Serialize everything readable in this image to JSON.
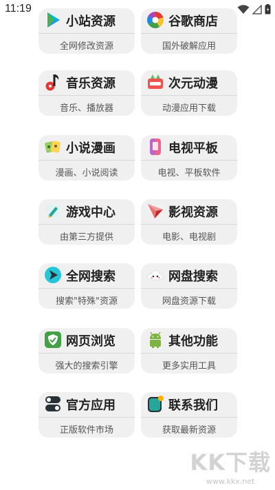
{
  "status_bar": {
    "time": "11:19"
  },
  "cards": [
    {
      "title": "小站资源",
      "subtitle": "全网修改资源",
      "icon": "play-triangle-icon"
    },
    {
      "title": "谷歌商店",
      "subtitle": "国外破解应用",
      "icon": "google-play-icon"
    },
    {
      "title": "音乐资源",
      "subtitle": "音乐、播放器",
      "icon": "music-note-icon"
    },
    {
      "title": "次元动漫",
      "subtitle": "动漫应用下载",
      "icon": "anime-box-icon"
    },
    {
      "title": "小说漫画",
      "subtitle": "漫画、小说阅读",
      "icon": "comic-book-icon"
    },
    {
      "title": "电视平板",
      "subtitle": "电视、平板软件",
      "icon": "tv-tablet-icon"
    },
    {
      "title": "游戏中心",
      "subtitle": "由第三方提供",
      "icon": "game-pencil-icon"
    },
    {
      "title": "影视资源",
      "subtitle": "电影、电视剧",
      "icon": "paper-plane-icon"
    },
    {
      "title": "全网搜索",
      "subtitle": "搜索\"特殊\"资源",
      "icon": "search-arrow-icon"
    },
    {
      "title": "网盘搜索",
      "subtitle": "网盘资源下载",
      "icon": "cloud-icon"
    },
    {
      "title": "网页浏览",
      "subtitle": "强大的搜索引擎",
      "icon": "browser-shield-icon"
    },
    {
      "title": "其他功能",
      "subtitle": "更多实用工具",
      "icon": "android-icon"
    },
    {
      "title": "官方应用",
      "subtitle": "正版软件市场",
      "icon": "toggle-switch-icon"
    },
    {
      "title": "联系我们",
      "subtitle": "获取最新资源",
      "icon": "contact-phone-icon"
    }
  ],
  "watermark": {
    "logo": "KK下载",
    "url": "www.kkx.net"
  }
}
